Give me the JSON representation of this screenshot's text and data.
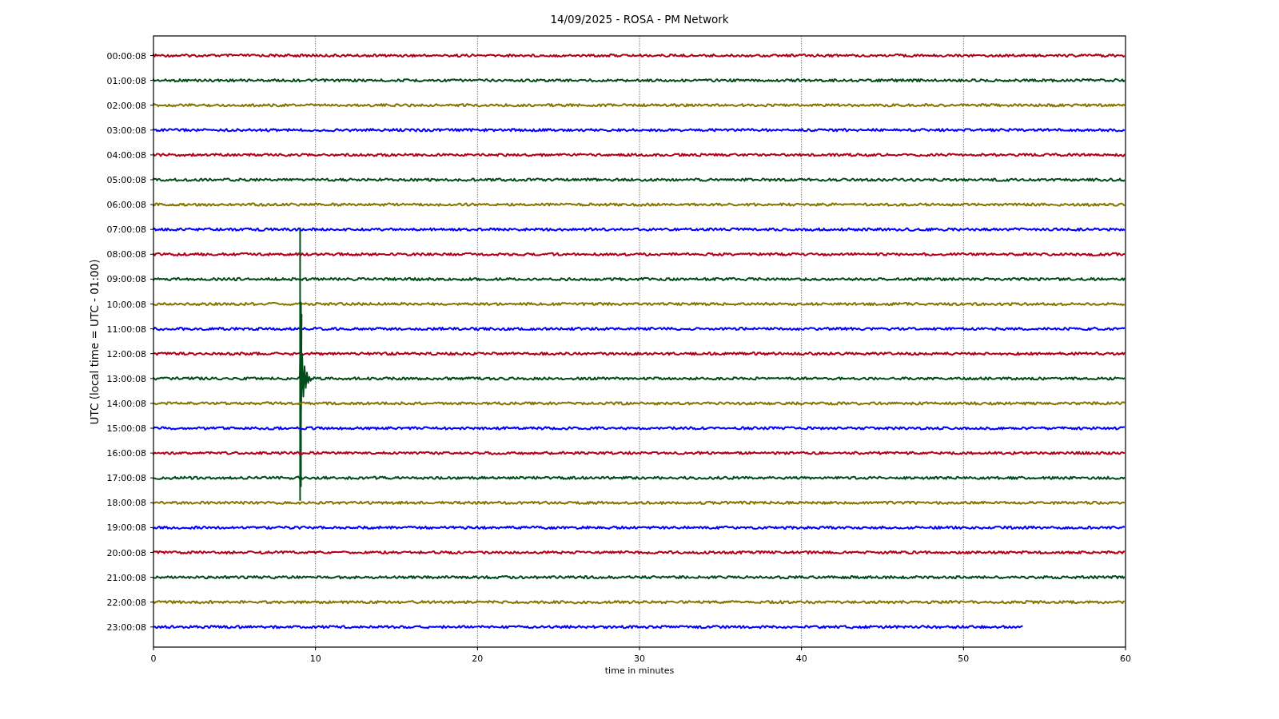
{
  "title": "14/09/2025 - ROSA - PM Network",
  "ylabel": "UTC (local time = UTC - 01:00)",
  "xlabel": "time in minutes",
  "xticks": [
    "0",
    "10",
    "20",
    "30",
    "40",
    "50",
    "60"
  ],
  "traces": [
    {
      "label": "00:00:08",
      "color": "#b5001b",
      "kind": "quiet",
      "level": 1
    },
    {
      "label": "01:00:08",
      "color": "#004d1a",
      "kind": "quiet",
      "level": 1
    },
    {
      "label": "02:00:08",
      "color": "#857400",
      "kind": "quiet",
      "level": 1
    },
    {
      "label": "03:00:08",
      "color": "#0000ff",
      "kind": "quiet",
      "level": 1
    },
    {
      "label": "04:00:08",
      "color": "#b5001b",
      "kind": "quiet",
      "level": 1
    },
    {
      "label": "05:00:08",
      "color": "#004d1a",
      "kind": "quiet",
      "level": 1
    },
    {
      "label": "06:00:08",
      "color": "#857400",
      "kind": "quiet",
      "level": 1
    },
    {
      "label": "07:00:08",
      "color": "#0000ff",
      "kind": "quiet",
      "level": 1
    },
    {
      "label": "08:00:08",
      "color": "#b5001b",
      "kind": "quiet",
      "level": 1
    },
    {
      "label": "09:00:08",
      "color": "#004d1a",
      "kind": "quiet",
      "level": 1
    },
    {
      "label": "10:00:08",
      "color": "#857400",
      "kind": "quiet",
      "level": 1
    },
    {
      "label": "11:00:08",
      "color": "#0000ff",
      "kind": "quiet",
      "level": 1
    },
    {
      "label": "12:00:08",
      "color": "#b5001b",
      "kind": "quiet",
      "level": 1
    },
    {
      "label": "13:00:08",
      "color": "#004d1a",
      "kind": "event",
      "level": 1
    },
    {
      "label": "14:00:08",
      "color": "#857400",
      "kind": "quiet",
      "level": 1
    },
    {
      "label": "15:00:08",
      "color": "#0000ff",
      "kind": "quiet",
      "level": 1
    },
    {
      "label": "16:00:08",
      "color": "#b5001b",
      "kind": "quiet",
      "level": 1
    },
    {
      "label": "17:00:08",
      "color": "#004d1a",
      "kind": "quiet",
      "level": 1
    },
    {
      "label": "18:00:08",
      "color": "#857400",
      "kind": "quiet",
      "level": 1
    },
    {
      "label": "19:00:08",
      "color": "#0000ff",
      "kind": "quiet",
      "level": 1
    },
    {
      "label": "20:00:08",
      "color": "#b5001b",
      "kind": "quiet",
      "level": 1
    },
    {
      "label": "21:00:08",
      "color": "#004d1a",
      "kind": "quiet",
      "level": 1
    },
    {
      "label": "22:00:08",
      "color": "#857400",
      "kind": "quiet",
      "level": 1
    },
    {
      "label": "23:00:08",
      "color": "#0000ff",
      "kind": "quiet",
      "level": 0.895
    }
  ]
}
